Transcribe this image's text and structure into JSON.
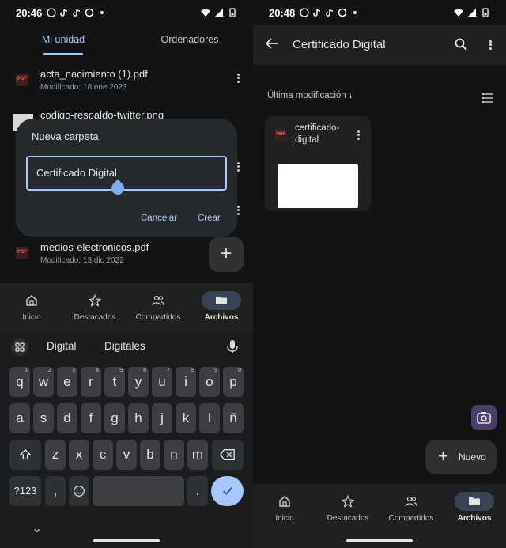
{
  "left": {
    "status": {
      "time": "20:46"
    },
    "tabs": [
      {
        "label": "Mi unidad"
      },
      {
        "label": "Ordenadores"
      }
    ],
    "files": [
      {
        "name": "acta_nacimiento (1).pdf",
        "date": "Modificado: 18 ene 2023"
      },
      {
        "name": "codigo-respaldo-twitter.png",
        "date": ""
      },
      {
        "name": "medios-electronicos.pdf",
        "date": "Modificado: 13 dic 2022"
      }
    ],
    "dialog": {
      "title": "Nueva carpeta",
      "input_value": "Certificado Digital",
      "cancel": "Cancelar",
      "create": "Crear"
    },
    "fab": {
      "plus": "+"
    },
    "nav": [
      {
        "label": "Inicio",
        "icon": "home-icon"
      },
      {
        "label": "Destacados",
        "icon": "star-icon"
      },
      {
        "label": "Compartidos",
        "icon": "people-icon"
      },
      {
        "label": "Archivos",
        "icon": "folder-icon",
        "active": true
      }
    ],
    "keyboard": {
      "suggestions": [
        "Digital",
        "Digitales"
      ],
      "row1": [
        {
          "k": "q",
          "n": "1"
        },
        {
          "k": "w",
          "n": "2"
        },
        {
          "k": "e",
          "n": "3"
        },
        {
          "k": "r",
          "n": "4"
        },
        {
          "k": "t",
          "n": "5"
        },
        {
          "k": "y",
          "n": "6"
        },
        {
          "k": "u",
          "n": "7"
        },
        {
          "k": "i",
          "n": "8"
        },
        {
          "k": "o",
          "n": "9"
        },
        {
          "k": "p",
          "n": "0"
        }
      ],
      "row2": [
        "a",
        "s",
        "d",
        "f",
        "g",
        "h",
        "j",
        "k",
        "l",
        "ñ"
      ],
      "row3": [
        "z",
        "x",
        "c",
        "v",
        "b",
        "n",
        "m"
      ],
      "sym": "?123",
      "comma": ",",
      "period": ".",
      "collapse": "⌄"
    }
  },
  "right": {
    "status": {
      "time": "20:48"
    },
    "title": "Certificado Digital",
    "sort": "Última modificación ↓",
    "card": {
      "name": "certificado-digital"
    },
    "nuevo": {
      "plus": "+",
      "label": "Nuevo"
    },
    "nav": [
      {
        "label": "Inicio",
        "icon": "home-icon"
      },
      {
        "label": "Destacados",
        "icon": "star-icon"
      },
      {
        "label": "Compartidos",
        "icon": "people-icon"
      },
      {
        "label": "Archivos",
        "icon": "folder-icon",
        "active": true
      }
    ]
  }
}
